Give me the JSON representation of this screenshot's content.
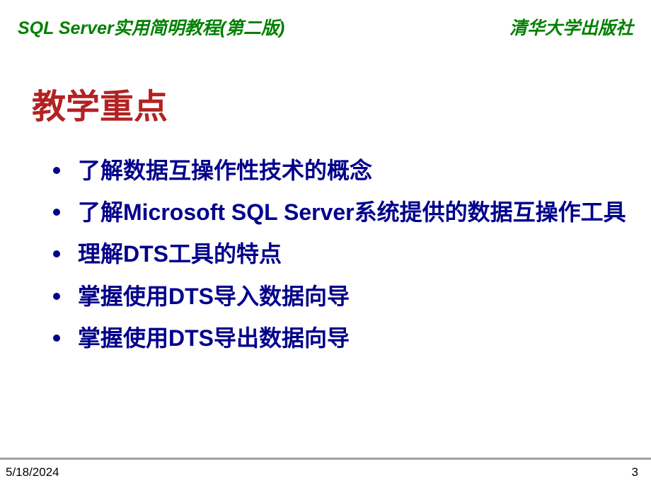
{
  "header": {
    "left": "SQL Server实用简明教程(第二版)",
    "right": "清华大学出版社"
  },
  "title": "教学重点",
  "bullets": [
    "了解数据互操作性技术的概念",
    "了解Microsoft SQL Server系统提供的数据互操作工具",
    "理解DTS工具的特点",
    "掌握使用DTS导入数据向导",
    "掌握使用DTS导出数据向导"
  ],
  "footer": {
    "date": "5/18/2024",
    "page": "3"
  }
}
